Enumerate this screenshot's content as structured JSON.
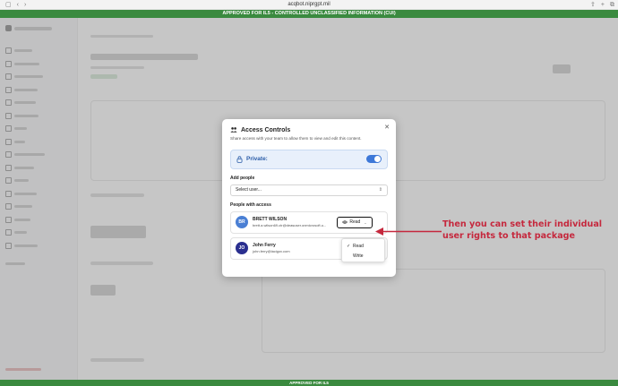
{
  "browser": {
    "url": "acqbot.niprgpt.mil",
    "banner_top": "APPROVED FOR IL5 - CONTROLLED UNCLASSIFIED INFORMATION (CUI)",
    "banner_bottom": "APPROVED FOR IL5"
  },
  "modal": {
    "title": "Access Controls",
    "description": "Share access with your team to allow them to view and edit this content.",
    "private_label": "Private:",
    "private_on": true,
    "add_people_label": "Add people",
    "select_placeholder": "Select user...",
    "people_label": "People with access",
    "people": [
      {
        "initials": "BR",
        "name": "BRETT WILSON",
        "email": "brett.a.wilson69.ctr@deasuser.onmicrosoft.u...",
        "permission": "Read",
        "avatar_color": "#4a7fd4"
      },
      {
        "initials": "JO",
        "name": "John Ferry",
        "email": "john.ferry@lacigov.com",
        "avatar_color": "#2a2f8f"
      }
    ],
    "menu_options": [
      "Read",
      "Write"
    ],
    "menu_selected": "Read"
  },
  "annotation": {
    "line1": "Then you can set their individual",
    "line2": "user rights to that package",
    "color": "#c5283d"
  }
}
